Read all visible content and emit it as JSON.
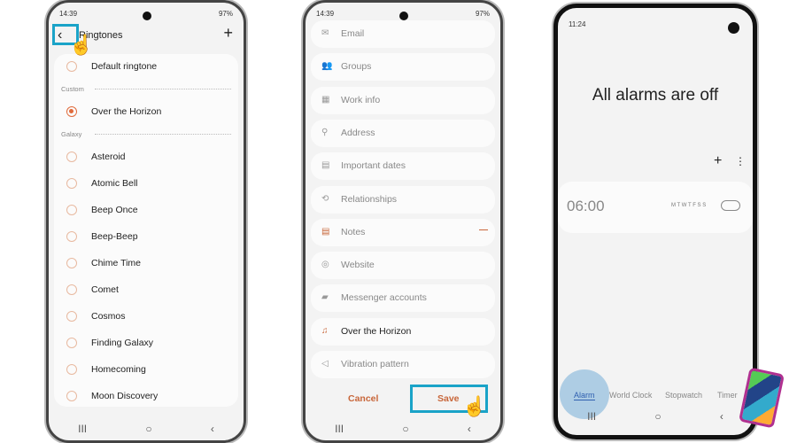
{
  "phone1": {
    "time": "14:39",
    "status_right": "97%",
    "title": "Ringtones",
    "add": "+",
    "default": "Default ringtone",
    "custom_label": "Custom",
    "selected": "Over the Horizon",
    "galaxy_label": "Galaxy",
    "items": [
      "Asteroid",
      "Atomic Bell",
      "Beep Once",
      "Beep-Beep",
      "Chime Time",
      "Comet",
      "Cosmos",
      "Finding Galaxy",
      "Homecoming",
      "Moon Discovery"
    ]
  },
  "phone2": {
    "time": "14:39",
    "status_right": "97%",
    "fields": [
      {
        "icon": "email-icon",
        "glyph": "✉",
        "label": "Email"
      },
      {
        "icon": "groups-icon",
        "glyph": "👥",
        "label": "Groups"
      },
      {
        "icon": "work-icon",
        "glyph": "▦",
        "label": "Work info"
      },
      {
        "icon": "location-icon",
        "glyph": "⚲",
        "label": "Address"
      },
      {
        "icon": "calendar-icon",
        "glyph": "▤",
        "label": "Important dates"
      },
      {
        "icon": "relationship-icon",
        "glyph": "⟲",
        "label": "Relationships"
      },
      {
        "icon": "notes-icon",
        "glyph": "▤",
        "label": "Notes"
      },
      {
        "icon": "globe-icon",
        "glyph": "◎",
        "label": "Website"
      },
      {
        "icon": "chat-icon",
        "glyph": "▰",
        "label": "Messenger accounts"
      },
      {
        "icon": "ringtone-icon",
        "glyph": "♫",
        "label": "Over the Horizon"
      },
      {
        "icon": "vibration-icon",
        "glyph": "◁",
        "label": "Vibration pattern"
      }
    ],
    "cancel": "Cancel",
    "save": "Save",
    "accent": "#c8663a"
  },
  "phone3": {
    "time": "11:24",
    "title": "All alarms are off",
    "alarm_time": "06:00",
    "days": "M T W T F S S",
    "tabs": [
      "Alarm",
      "World Clock",
      "Stopwatch",
      "Timer"
    ]
  },
  "nav": {
    "recents": "III",
    "home": "○",
    "back": "‹"
  }
}
